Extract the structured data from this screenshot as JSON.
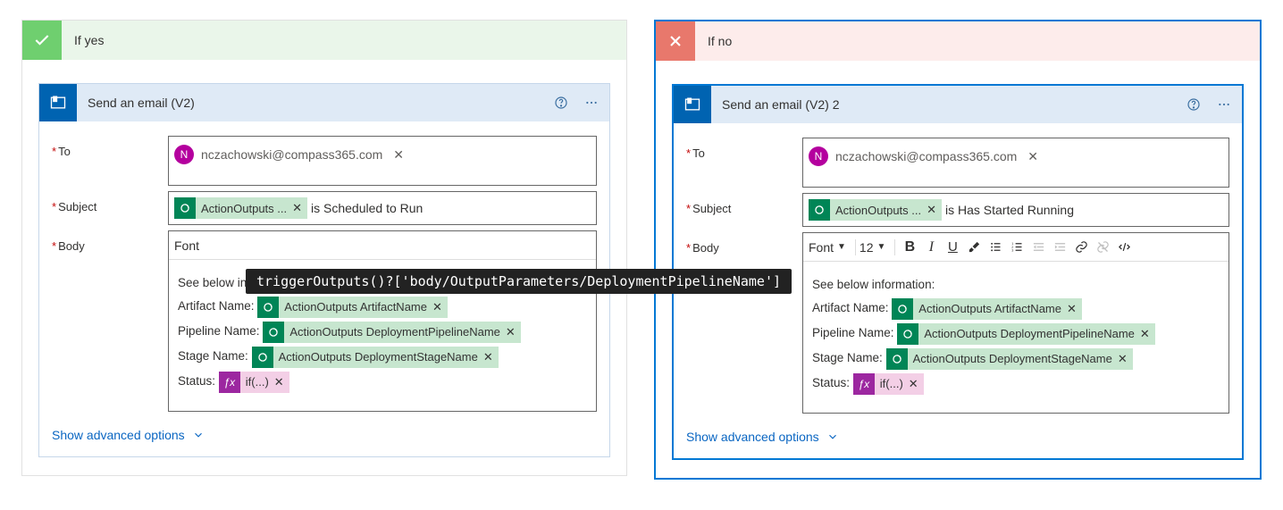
{
  "branches": {
    "yes": {
      "title": "If yes",
      "icon": "check-icon"
    },
    "no": {
      "title": "If no",
      "icon": "x-icon"
    }
  },
  "cards": {
    "left": {
      "title": "Send an email (V2)",
      "to": {
        "avatar": "N",
        "email": "nczachowski@compass365.com"
      },
      "subject_token": "ActionOutputs ...",
      "subject_suffix": "is Scheduled to Run",
      "font_label": "Font",
      "body": {
        "intro": "See below information:",
        "lines": [
          {
            "label": "Artifact Name:",
            "token": "ActionOutputs ArtifactName"
          },
          {
            "label": "Pipeline Name:",
            "token": "ActionOutputs DeploymentPipelineName"
          },
          {
            "label": "Stage Name:",
            "token": "ActionOutputs DeploymentStageName"
          },
          {
            "label": "Status:",
            "token": "if(...)",
            "fx": true
          }
        ]
      }
    },
    "right": {
      "title": "Send an email (V2) 2",
      "to": {
        "avatar": "N",
        "email": "nczachowski@compass365.com"
      },
      "subject_token": "ActionOutputs ...",
      "subject_suffix": "is Has Started Running",
      "font_label": "Font",
      "font_size": "12",
      "body": {
        "intro": "See below information:",
        "lines": [
          {
            "label": "Artifact Name:",
            "token": "ActionOutputs ArtifactName"
          },
          {
            "label": "Pipeline Name:",
            "token": "ActionOutputs DeploymentPipelineName"
          },
          {
            "label": "Stage Name:",
            "token": "ActionOutputs DeploymentStageName"
          },
          {
            "label": "Status:",
            "token": "if(...)",
            "fx": true
          }
        ]
      }
    }
  },
  "labels": {
    "to": "To",
    "subject": "Subject",
    "body": "Body",
    "advanced": "Show advanced options"
  },
  "tooltip": "triggerOutputs()?['body/OutputParameters/DeploymentPipelineName']"
}
